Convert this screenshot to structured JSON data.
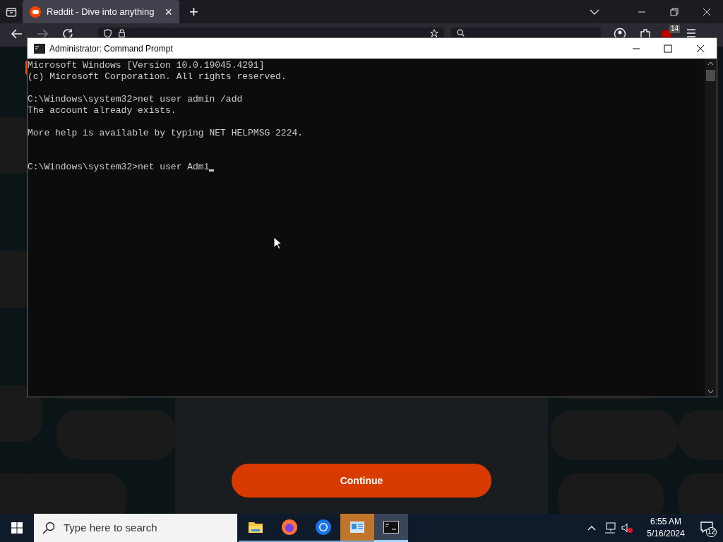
{
  "browser": {
    "tab": {
      "title": "Reddit - Dive into anything",
      "close": "×",
      "selected": true
    },
    "new_tab": "+",
    "extension_badge": "14"
  },
  "page": {
    "button": "Continue"
  },
  "console_window": {
    "title": "Administrator: Command Prompt",
    "blocks": [
      [
        "Microsoft Windows [Version 10.0.19045.4291]",
        "(c) Microsoft Corporation. All rights reserved."
      ],
      [
        "C:\\Windows\\system32>net user admin /add",
        "The account already exists."
      ],
      [
        "More help is available by typing NET HELPMSG 2224."
      ]
    ],
    "input_line": "C:\\Windows\\system32>net user Admi"
  },
  "taskbar": {
    "search": {
      "placeholder": "Type here to search"
    },
    "apps": [
      {
        "kind": "folder",
        "selected": false,
        "flashing": false
      },
      {
        "kind": "firefox",
        "selected": false,
        "flashing": false
      },
      {
        "kind": "chrome",
        "selected": false,
        "flashing": false
      },
      {
        "kind": "panel",
        "selected": false,
        "flashing": true
      },
      {
        "kind": "console",
        "selected": true,
        "flashing": false
      }
    ],
    "time": "6:55 AM",
    "date": "5/16/2024",
    "notifications": "12"
  }
}
